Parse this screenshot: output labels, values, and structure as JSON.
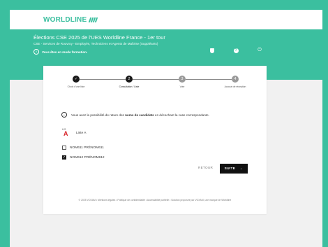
{
  "header": {
    "logo_text": "WORLDLINE"
  },
  "banner": {
    "title": "Élections CSE 2025 de l'UES Worldline France - 1er tour",
    "subtitle": "CSE - Services de Rouvroy - Employés, Techniciens et Agents de Maîtrise (Suppléants)",
    "mode_text": "Vous êtes en mode formation.",
    "icons": [
      "shield-icon",
      "help-icon",
      "power-icon"
    ]
  },
  "stepper": {
    "steps": [
      {
        "label": "Choix d'une liste",
        "state": "done"
      },
      {
        "label": "Consultation / Liste",
        "state": "active",
        "number": "2"
      },
      {
        "label": "Vote",
        "state": "todo",
        "number": "3"
      },
      {
        "label": "Accusé de réception",
        "state": "todo",
        "number": "4"
      }
    ]
  },
  "info": {
    "before": "Vous avez la possibilité de rature des ",
    "bold": "noms de candidats",
    "after": " en décochant la case correspondante."
  },
  "list": {
    "logo_small": "LIS",
    "logo_big": "A",
    "name": "Liste A"
  },
  "candidates": [
    {
      "name": "NOM611 PRÉNOM611",
      "checked": false
    },
    {
      "name": "NOM612 PRÉNOM612",
      "checked": true
    }
  ],
  "actions": {
    "back_label": "RETOUR",
    "next_label": "SUITE"
  },
  "footer": {
    "text": "© 2025 VOXAM  •  Mentions légales  •  Politique de confidentialité  •  Accessibilité partielle  •  Solution proposée par VOXAM, une marque de Worldline"
  },
  "colors": {
    "brand": "#3bbf9f",
    "dark": "#1a1a1a",
    "list_logo": "#d8262c"
  }
}
